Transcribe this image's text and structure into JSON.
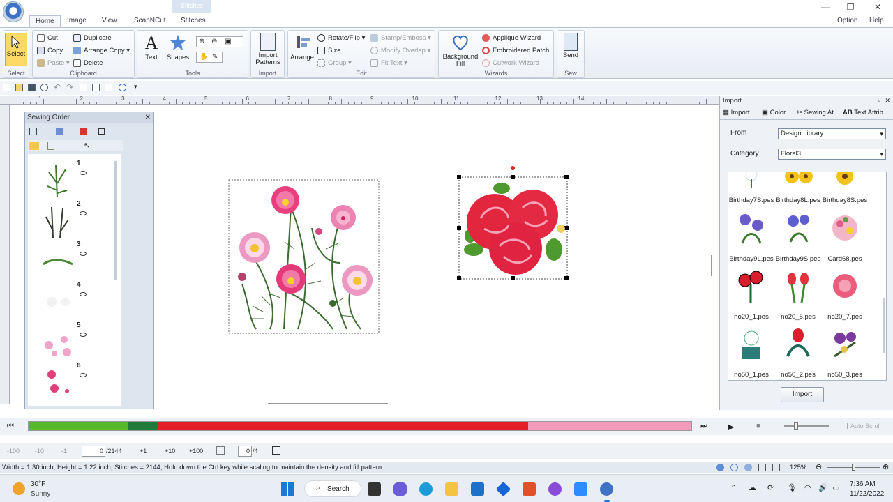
{
  "titlebar": {
    "stitches_tab": "Stitches"
  },
  "ribbon_tabs": [
    "Home",
    "Image",
    "View",
    "ScanNCut",
    "Stitches"
  ],
  "help": {
    "option": "Option",
    "help": "Help"
  },
  "groups": {
    "select": {
      "label": "Select",
      "button": "Select"
    },
    "clipboard": {
      "label": "Clipboard",
      "cut": "Cut",
      "copy": "Copy",
      "paste": "Paste",
      "duplicate": "Duplicate",
      "arrange_copy": "Arrange Copy",
      "delete": "Delete"
    },
    "tools": {
      "label": "Tools",
      "text": "Text",
      "shapes": "Shapes"
    },
    "import": {
      "label": "Import",
      "button": "Import Patterns"
    },
    "edit": {
      "label": "Edit",
      "arrange": "Arrange",
      "rotate_flip": "Rotate/Flip",
      "size": "Size...",
      "group": "Group",
      "stamp_emboss": "Stamp/Emboss",
      "modify_overlap": "Modify Overlap",
      "fit_text": "Fit Text"
    },
    "wizards": {
      "label": "Wizards",
      "background_fill": "Background Fill",
      "applique": "Applique Wizard",
      "embroidered_patch": "Embroidered Patch",
      "cutwork": "Cutwork Wizard"
    },
    "sew": {
      "label": "Sew",
      "send": "Send"
    }
  },
  "ruler": {
    "numbers": [
      "1",
      "2",
      "3",
      "4",
      "5",
      "6",
      "7",
      "8",
      "9",
      "10",
      "11",
      "12",
      "13",
      "14"
    ]
  },
  "sewing_order": {
    "title": "Sewing Order",
    "items": [
      {
        "num": "1"
      },
      {
        "num": "2"
      },
      {
        "num": "3"
      },
      {
        "num": "4"
      },
      {
        "num": "5"
      },
      {
        "num": "6"
      }
    ]
  },
  "import_panel": {
    "title": "Import",
    "tabs": [
      "Import",
      "Color",
      "Sewing At...",
      "Text Attrib..."
    ],
    "from_label": "From",
    "from_value": "Design Library",
    "category_label": "Category",
    "category_value": "Floral3",
    "items": [
      "Birthday7S.pes",
      "Birthday8L.pes",
      "Birthday8S.pes",
      "Birthday9L.pes",
      "Birthday9S.pes",
      "Card68.pes",
      "no20_1.pes",
      "no20_5.pes",
      "no20_7.pes",
      "no50_1.pes",
      "no50_2.pes",
      "no50_3.pes"
    ],
    "import_button": "Import"
  },
  "progress": {
    "autoscroll": "Auto Scroll"
  },
  "stitchbar": {
    "m100": "-100",
    "m10": "-10",
    "m1": "-1",
    "count": "0",
    "total": "/2144",
    "p1": "+1",
    "p10": "+10",
    "p100": "+100",
    "color_pos": "0",
    "color_total": "/4"
  },
  "status": {
    "text": "Width = 1.30 inch, Height = 1.22 inch, Stitches = 2144, Hold down the Ctrl key while scaling to maintain the density and fill pattern.",
    "zoom": "125%"
  },
  "taskbar": {
    "temp": "30°F",
    "weather": "Sunny",
    "search": "Search",
    "time": "7:36 AM",
    "date": "11/22/2022"
  }
}
